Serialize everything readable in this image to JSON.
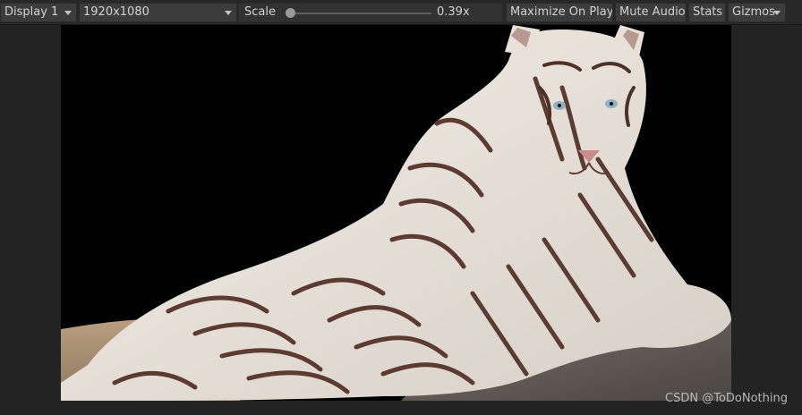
{
  "toolbar": {
    "display_label": "Display 1",
    "resolution_label": "1920x1080",
    "scale_label": "Scale",
    "scale_value": "0.39x",
    "scale_fraction": 0.01,
    "maximize_label": "Maximize On Play",
    "mute_label": "Mute Audio",
    "stats_label": "Stats",
    "gizmos_label": "Gizmos"
  },
  "viewport": {
    "content": "white-tiger-photo"
  },
  "watermark": "CSDN @ToDoNothing",
  "colors": {
    "toolbar_bg": "#282828",
    "button_bg": "#3c3c3c",
    "text": "#d2d2d2",
    "panel_bg": "#232323"
  }
}
